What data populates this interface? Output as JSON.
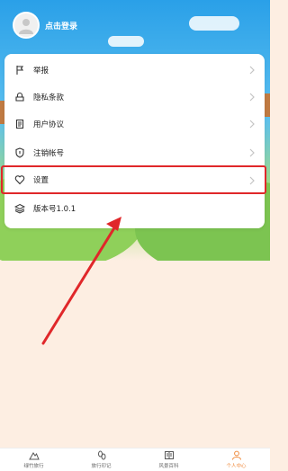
{
  "profile": {
    "login_text": "点击登录"
  },
  "menu": {
    "items": [
      {
        "label": "举报",
        "icon": "report-icon"
      },
      {
        "label": "隐私条款",
        "icon": "privacy-icon"
      },
      {
        "label": "用户协议",
        "icon": "agreement-icon"
      },
      {
        "label": "注销帐号",
        "icon": "shield-icon"
      },
      {
        "label": "设置",
        "icon": "heart-icon"
      },
      {
        "label": "版本号1.0.1",
        "icon": "layers-icon"
      }
    ]
  },
  "tabbar": {
    "tabs": [
      {
        "label": "绿竹旅行",
        "icon": "mountain-icon"
      },
      {
        "label": "旅行印记",
        "icon": "footprint-icon"
      },
      {
        "label": "风景百科",
        "icon": "book-icon"
      },
      {
        "label": "个人中心",
        "icon": "person-icon",
        "active": true
      }
    ]
  },
  "colors": {
    "accent": "#f08a3c",
    "highlight_border": "#e0272a",
    "arrow": "#e0272a",
    "sky": "#2aa0e8",
    "page_bg": "#fdeee2"
  }
}
